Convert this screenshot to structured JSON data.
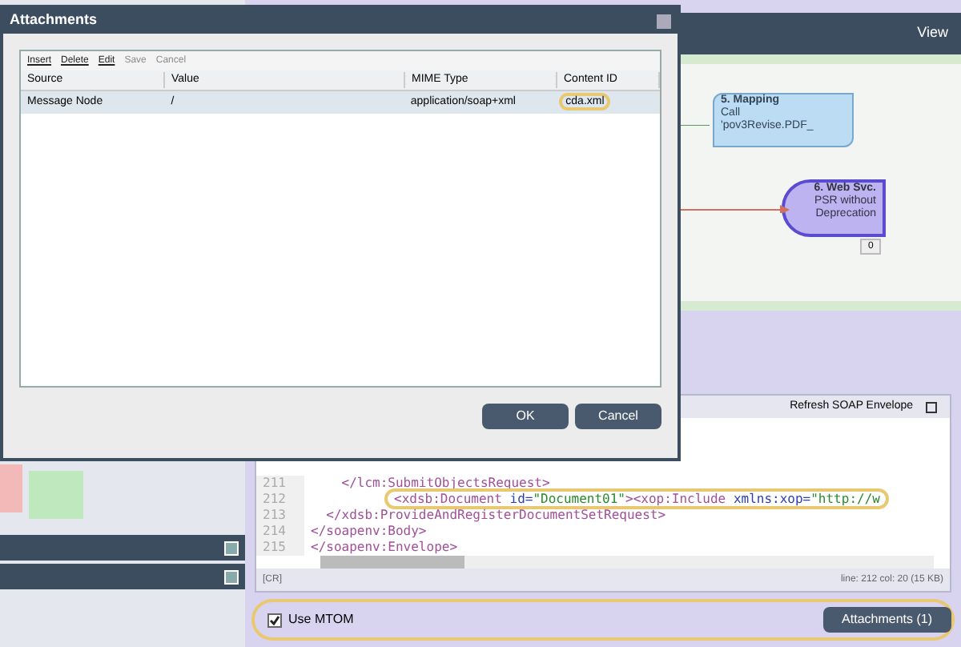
{
  "header": {
    "view_label": "View"
  },
  "diagram": {
    "nodes": [
      {
        "kind": "mapping",
        "title": "5. Mapping",
        "lines": [
          "Call",
          "'pov3Revise.PDF_"
        ]
      },
      {
        "kind": "service",
        "title": "6. Web Svc.",
        "lines": [
          "PSR without",
          "Deprecation"
        ],
        "badge": "0"
      }
    ]
  },
  "editor": {
    "refresh_label": "Refresh SOAP Envelope",
    "lines": [
      {
        "number": "211",
        "highlighted": false,
        "tokens": [
          {
            "kind": "tag",
            "text": "    </lcm:SubmitObjectsRequest>"
          }
        ]
      },
      {
        "number": "212",
        "highlighted": true,
        "tokens": [
          {
            "kind": "tag",
            "text": "<xdsb:Document"
          },
          {
            "kind": "attr",
            "text": " id="
          },
          {
            "kind": "value",
            "text": "\"Document01\""
          },
          {
            "kind": "tag",
            "text": "><xop:Include"
          },
          {
            "kind": "attr",
            "text": " xmlns:xop="
          },
          {
            "kind": "value",
            "text": "\"http://w"
          }
        ]
      },
      {
        "number": "213",
        "highlighted": false,
        "tokens": [
          {
            "kind": "tag",
            "text": "  </xdsb:ProvideAndRegisterDocumentSetRequest>"
          }
        ]
      },
      {
        "number": "214",
        "highlighted": false,
        "tokens": [
          {
            "kind": "tag",
            "text": "</soapenv:Body>"
          }
        ]
      },
      {
        "number": "215",
        "highlighted": false,
        "tokens": [
          {
            "kind": "tag",
            "text": "</soapenv:Envelope>"
          }
        ]
      }
    ],
    "status_left": "[CR]",
    "status_right": "line: 212  col: 20  (15 KB)"
  },
  "mtom": {
    "label": "Use MTOM",
    "checked": true,
    "highlighted": true,
    "attachments_button": "Attachments (1)"
  },
  "dialog": {
    "title": "Attachments",
    "toolbar": [
      {
        "label": "Insert",
        "disabled": false
      },
      {
        "label": "Delete",
        "disabled": false
      },
      {
        "label": "Edit",
        "disabled": false
      },
      {
        "label": "Save",
        "disabled": true
      },
      {
        "label": "Cancel",
        "disabled": true
      }
    ],
    "columns": [
      "Source",
      "Value",
      "MIME Type",
      "Content ID"
    ],
    "rows": [
      {
        "selected": true,
        "cells": [
          {
            "text": "Message Node",
            "highlighted": false
          },
          {
            "text": "/",
            "highlighted": false
          },
          {
            "text": "application/soap+xml",
            "highlighted": false
          },
          {
            "text": "cda.xml",
            "highlighted": true
          }
        ]
      }
    ],
    "buttons": [
      "OK",
      "Cancel"
    ]
  }
}
